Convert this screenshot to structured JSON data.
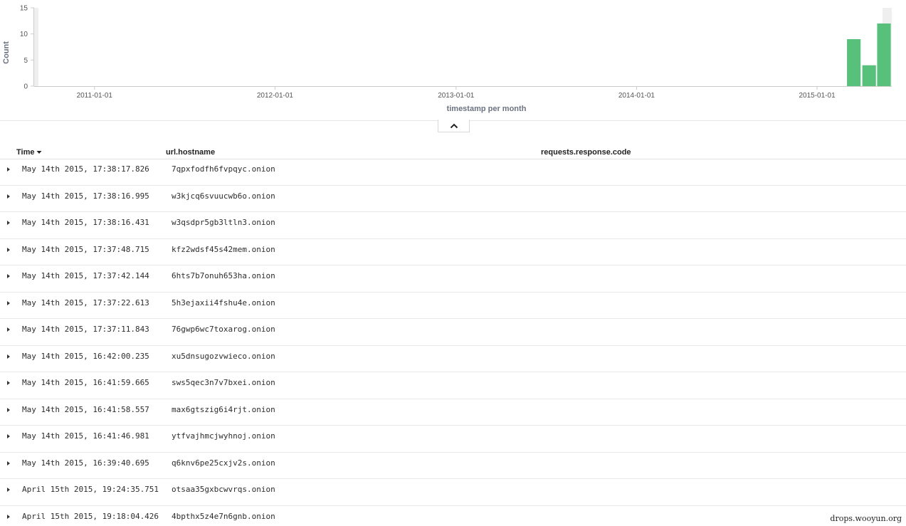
{
  "chart_data": {
    "type": "bar",
    "title": "",
    "xlabel": "timestamp per month",
    "ylabel": "Count",
    "ylim": [
      0,
      15
    ],
    "yticks": [
      0,
      5,
      10,
      15
    ],
    "x_ticks": [
      "2011-01-01",
      "2012-01-01",
      "2013-01-01",
      "2014-01-01",
      "2015-01-01"
    ],
    "x_range": [
      "2010-09-01",
      "2015-06-01"
    ],
    "grid": false,
    "bar_color": "#57c17b",
    "bars": [
      {
        "x": "2015-03-01",
        "value": 9
      },
      {
        "x": "2015-04-01",
        "value": 4
      },
      {
        "x": "2015-05-01",
        "value": 12
      }
    ]
  },
  "table": {
    "columns": {
      "time": "Time",
      "hostname": "url.hostname",
      "response_code": "requests.response.code"
    },
    "rows": [
      {
        "time": "May 14th 2015, 17:38:17.826",
        "hostname": "7qpxfodfh6fvpqyc.onion"
      },
      {
        "time": "May 14th 2015, 17:38:16.995",
        "hostname": "w3kjcq6svuucwb6o.onion"
      },
      {
        "time": "May 14th 2015, 17:38:16.431",
        "hostname": "w3qsdpr5gb3ltln3.onion"
      },
      {
        "time": "May 14th 2015, 17:37:48.715",
        "hostname": "kfz2wdsf45s42mem.onion"
      },
      {
        "time": "May 14th 2015, 17:37:42.144",
        "hostname": "6hts7b7onuh653ha.onion"
      },
      {
        "time": "May 14th 2015, 17:37:22.613",
        "hostname": "5h3ejaxii4fshu4e.onion"
      },
      {
        "time": "May 14th 2015, 17:37:11.843",
        "hostname": "76gwp6wc7toxarog.onion"
      },
      {
        "time": "May 14th 2015, 16:42:00.235",
        "hostname": "xu5dnsugozvwieco.onion"
      },
      {
        "time": "May 14th 2015, 16:41:59.665",
        "hostname": "sws5qec3n7v7bxei.onion"
      },
      {
        "time": "May 14th 2015, 16:41:58.557",
        "hostname": "max6gtszig6i4rjt.onion"
      },
      {
        "time": "May 14th 2015, 16:41:46.981",
        "hostname": "ytfvajhmcjwyhnoj.onion"
      },
      {
        "time": "May 14th 2015, 16:39:40.695",
        "hostname": "q6knv6pe25cxjv2s.onion"
      },
      {
        "time": "April 15th 2015, 19:24:35.751",
        "hostname": "otsaa35gxbcwvrqs.onion"
      },
      {
        "time": "April 15th 2015, 19:18:04.426",
        "hostname": "4bpthx5z4e7n6gnb.onion"
      }
    ]
  },
  "watermark": "drops.wooyun.org",
  "icons": {
    "collapse": "chevron-up-icon",
    "sort": "sort-descending-icon",
    "expand": "caret-right-icon"
  }
}
